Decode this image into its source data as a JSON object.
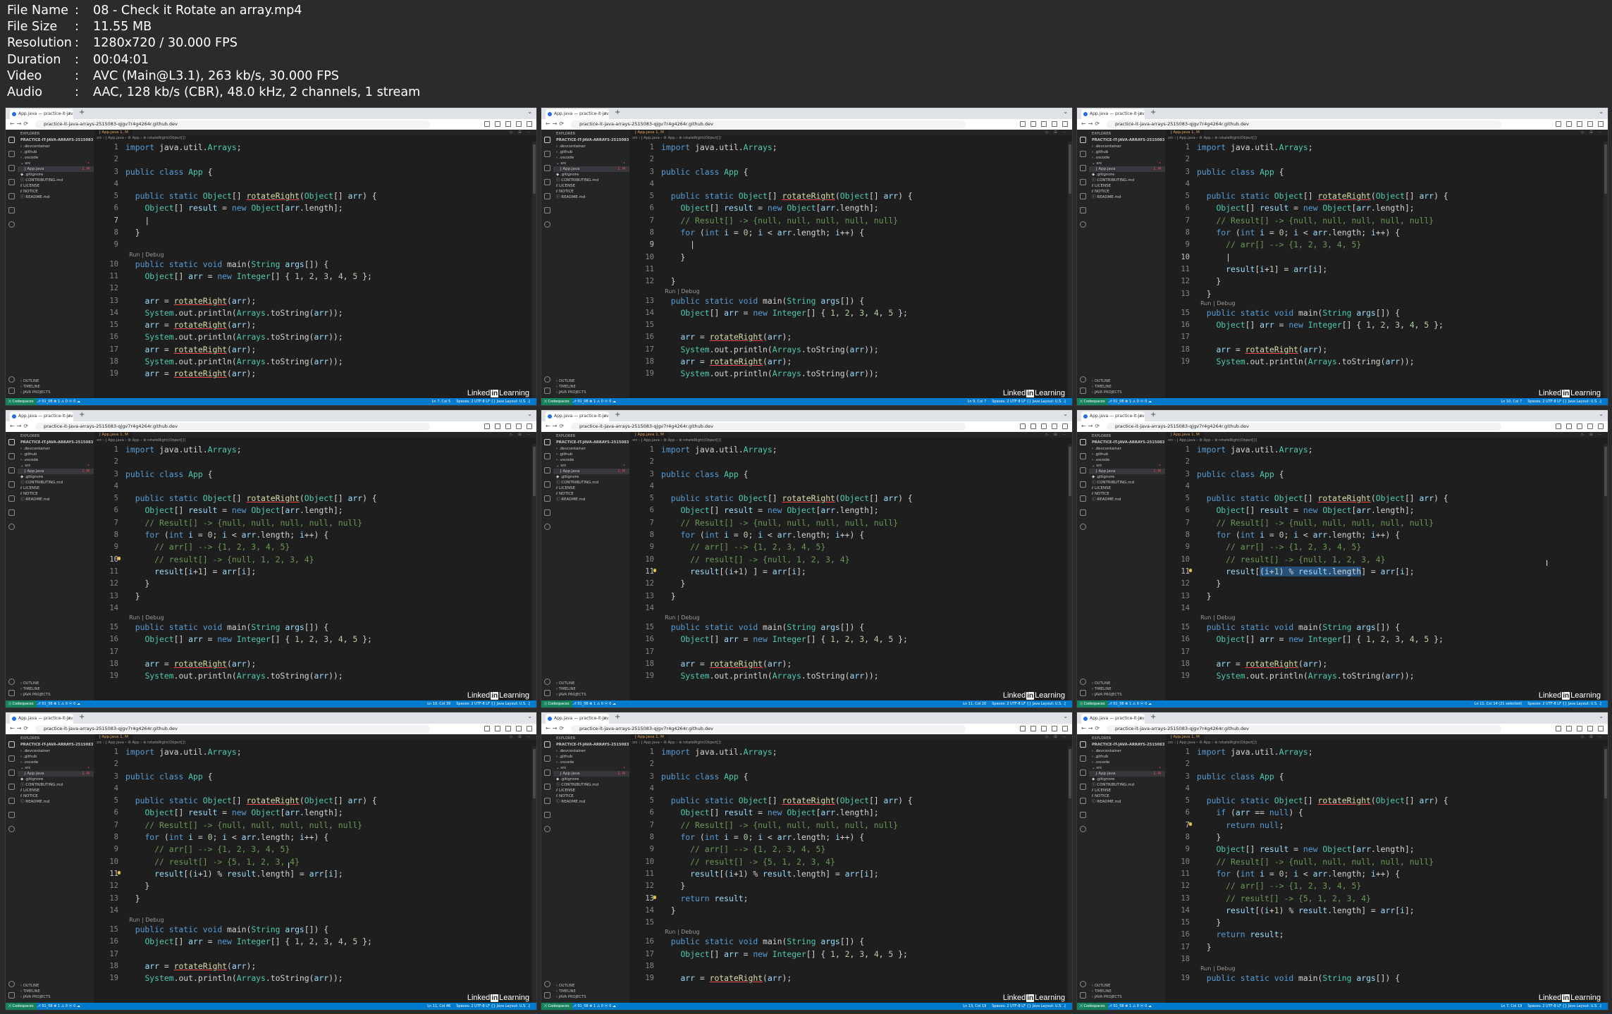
{
  "media_info": [
    {
      "label": "File Name",
      "value": "08 - Check it Rotate an array.mp4"
    },
    {
      "label": "File Size",
      "value": "11.55 MB"
    },
    {
      "label": "Resolution",
      "value": "1280x720 / 30.000 FPS"
    },
    {
      "label": "Duration",
      "value": "00:04:01"
    },
    {
      "label": "Video",
      "value": "AVC (Main@L3.1), 263 kb/s, 30.000 FPS"
    },
    {
      "label": "Audio",
      "value": "AAC, 128 kb/s (CBR), 48.0 kHz, 2 channels, 1 stream"
    }
  ],
  "browser": {
    "tab_title": "App.java — practice-it-java-a",
    "url": "practice-it-java-arrays-2515083-qjgv7r4g4264r.github.dev"
  },
  "explorer": {
    "title": "EXPLORER",
    "root": "PRACTICE-IT-JAVA-ARRAYS-2515083 [CODESPACES]",
    "items": [
      {
        "label": "› .devcontainer",
        "badge": "",
        "indent": 4
      },
      {
        "label": "› .github",
        "badge": "",
        "indent": 4
      },
      {
        "label": "› .vscode",
        "badge": "",
        "indent": 4
      },
      {
        "label": "⌄ src",
        "badge": "•",
        "badge_color": "red",
        "indent": 4
      },
      {
        "label": "J App.java",
        "badge": "1, M",
        "badge_color": "red",
        "indent": 10,
        "selected": true
      },
      {
        "label": "◆ .gitignore",
        "badge": "",
        "indent": 4
      },
      {
        "label": "ⓘ CONTRIBUTING.md",
        "badge": "",
        "indent": 4
      },
      {
        "label": "ℓ LICENSE",
        "badge": "",
        "indent": 4
      },
      {
        "label": "ℓ NOTICE",
        "badge": "",
        "indent": 4
      },
      {
        "label": "ⓘ README.md",
        "badge": "",
        "indent": 4
      }
    ],
    "bottom": [
      "› OUTLINE",
      "› TIMELINE",
      "› JAVA PROJECTS"
    ]
  },
  "editor": {
    "tab_label": "J App.java 1, M",
    "breadcrumb": "src › J App.java › ⚙ App › ⊕ rotateRight(Object[])"
  },
  "status": {
    "remote": "⟩⟨ Codespaces",
    "left": "⎇ 01_08   ⊗ 1 ⚠ 0   ⓦ 0   ☁",
    "right": "Spaces: 2   UTF-8   LF   {} Java   Layout: U.S.   ♫"
  },
  "watermark": {
    "pre": "Linked",
    "box": "in",
    "post": "Learning"
  },
  "frames": [
    {
      "status_pos": "Ln 7, Col 5",
      "lines": [
        {
          "n": "1",
          "t": "import java.util.Arrays;"
        },
        {
          "n": "2",
          "t": ""
        },
        {
          "n": "3",
          "t": "public class App {"
        },
        {
          "n": "4",
          "t": ""
        },
        {
          "n": "5",
          "t": "  public static Object[] rotateRight(Object[] arr) {"
        },
        {
          "n": "6",
          "t": "    Object[] result = new Object[arr.length];"
        },
        {
          "n": "7",
          "t": "    |",
          "cur": true
        },
        {
          "n": "8",
          "t": "  }"
        },
        {
          "n": "9",
          "t": ""
        },
        {
          "n": "",
          "t": "  Run | Debug",
          "lens": true
        },
        {
          "n": "10",
          "t": "  public static void main(String args[]) {"
        },
        {
          "n": "11",
          "t": "    Object[] arr = new Integer[] { 1, 2, 3, 4, 5 };"
        },
        {
          "n": "12",
          "t": ""
        },
        {
          "n": "13",
          "t": "    arr = rotateRight(arr);"
        },
        {
          "n": "14",
          "t": "    System.out.println(Arrays.toString(arr));"
        },
        {
          "n": "15",
          "t": "    arr = rotateRight(arr);"
        },
        {
          "n": "16",
          "t": "    System.out.println(Arrays.toString(arr));"
        },
        {
          "n": "17",
          "t": "    arr = rotateRight(arr);"
        },
        {
          "n": "18",
          "t": "    System.out.println(Arrays.toString(arr));"
        },
        {
          "n": "19",
          "t": "    arr = rotateRight(arr);"
        }
      ]
    },
    {
      "status_pos": "Ln 9, Col 7",
      "lines": [
        {
          "n": "1",
          "t": "import java.util.Arrays;"
        },
        {
          "n": "2",
          "t": ""
        },
        {
          "n": "3",
          "t": "public class App {"
        },
        {
          "n": "4",
          "t": ""
        },
        {
          "n": "5",
          "t": "  public static Object[] rotateRight(Object[] arr) {"
        },
        {
          "n": "6",
          "t": "    Object[] result = new Object[arr.length];"
        },
        {
          "n": "7",
          "t": "    // Result[] -> {null, null, null, null, null}"
        },
        {
          "n": "8",
          "t": "    for (int i = 0; i < arr.length; i++) {"
        },
        {
          "n": "9",
          "t": "      |",
          "cur": true
        },
        {
          "n": "10",
          "t": "    }"
        },
        {
          "n": "11",
          "t": ""
        },
        {
          "n": "12",
          "t": "  }"
        },
        {
          "n": "",
          "t": "  Run | Debug",
          "lens": true
        },
        {
          "n": "13",
          "t": "  public static void main(String args[]) {"
        },
        {
          "n": "14",
          "t": "    Object[] arr = new Integer[] { 1, 2, 3, 4, 5 };"
        },
        {
          "n": "15",
          "t": ""
        },
        {
          "n": "16",
          "t": "    arr = rotateRight(arr);"
        },
        {
          "n": "17",
          "t": "    System.out.println(Arrays.toString(arr));"
        },
        {
          "n": "18",
          "t": "    arr = rotateRight(arr);"
        },
        {
          "n": "19",
          "t": "    System.out.println(Arrays.toString(arr));"
        }
      ]
    },
    {
      "status_pos": "Ln 10, Col 7",
      "lines": [
        {
          "n": "1",
          "t": "import java.util.Arrays;"
        },
        {
          "n": "2",
          "t": ""
        },
        {
          "n": "3",
          "t": "public class App {"
        },
        {
          "n": "4",
          "t": ""
        },
        {
          "n": "5",
          "t": "  public static Object[] rotateRight(Object[] arr) {"
        },
        {
          "n": "6",
          "t": "    Object[] result = new Object[arr.length];"
        },
        {
          "n": "7",
          "t": "    // Result[] -> {null, null, null, null, null}"
        },
        {
          "n": "8",
          "t": "    for (int i = 0; i < arr.length; i++) {"
        },
        {
          "n": "9",
          "t": "      // arr[] --> {1, 2, 3, 4, 5}"
        },
        {
          "n": "10",
          "t": "      |",
          "cur": true
        },
        {
          "n": "11",
          "t": "      result[i+1] = arr[i];"
        },
        {
          "n": "12",
          "t": "    }"
        },
        {
          "n": "13",
          "t": "  }"
        },
        {
          "n": "",
          "t": "  Run | Debug",
          "lens": true
        },
        {
          "n": "15",
          "t": "  public static void main(String args[]) {"
        },
        {
          "n": "16",
          "t": "    Object[] arr = new Integer[] { 1, 2, 3, 4, 5 };"
        },
        {
          "n": "17",
          "t": ""
        },
        {
          "n": "18",
          "t": "    arr = rotateRight(arr);"
        },
        {
          "n": "19",
          "t": "    System.out.println(Arrays.toString(arr));"
        }
      ]
    },
    {
      "status_pos": "Ln 10, Col 39",
      "lines": [
        {
          "n": "1",
          "t": "import java.util.Arrays;"
        },
        {
          "n": "2",
          "t": ""
        },
        {
          "n": "3",
          "t": "public class App {"
        },
        {
          "n": "4",
          "t": ""
        },
        {
          "n": "5",
          "t": "  public static Object[] rotateRight(Object[] arr) {"
        },
        {
          "n": "6",
          "t": "    Object[] result = new Object[arr.length];"
        },
        {
          "n": "7",
          "t": "    // Result[] -> {null, null, null, null, null}"
        },
        {
          "n": "8",
          "t": "    for (int i = 0; i < arr.length; i++) {"
        },
        {
          "n": "9",
          "t": "      // arr[] --> {1, 2, 3, 4, 5}"
        },
        {
          "n": "10",
          "t": "      // result[] -> {null, 1, 2, 3, 4}",
          "cur": true,
          "bulb": true
        },
        {
          "n": "11",
          "t": "      result[i+1] = arr[i];"
        },
        {
          "n": "12",
          "t": "    }"
        },
        {
          "n": "13",
          "t": "  }"
        },
        {
          "n": "14",
          "t": ""
        },
        {
          "n": "",
          "t": "  Run | Debug",
          "lens": true
        },
        {
          "n": "15",
          "t": "  public static void main(String args[]) {"
        },
        {
          "n": "16",
          "t": "    Object[] arr = new Integer[] { 1, 2, 3, 4, 5 };"
        },
        {
          "n": "17",
          "t": ""
        },
        {
          "n": "18",
          "t": "    arr = rotateRight(arr);"
        },
        {
          "n": "19",
          "t": "    System.out.println(Arrays.toString(arr));"
        }
      ]
    },
    {
      "status_pos": "Ln 11, Col 20",
      "lines": [
        {
          "n": "1",
          "t": "import java.util.Arrays;"
        },
        {
          "n": "2",
          "t": ""
        },
        {
          "n": "3",
          "t": "public class App {"
        },
        {
          "n": "4",
          "t": ""
        },
        {
          "n": "5",
          "t": "  public static Object[] rotateRight(Object[] arr) {"
        },
        {
          "n": "6",
          "t": "    Object[] result = new Object[arr.length];"
        },
        {
          "n": "7",
          "t": "    // Result[] -> {null, null, null, null, null}"
        },
        {
          "n": "8",
          "t": "    for (int i = 0; i < arr.length; i++) {"
        },
        {
          "n": "9",
          "t": "      // arr[] --> {1, 2, 3, 4, 5}"
        },
        {
          "n": "10",
          "t": "      // result[] -> {null, 1, 2, 3, 4}"
        },
        {
          "n": "11",
          "t": "      result[(i+1) ] = arr[i];",
          "cur": true,
          "bulb": true
        },
        {
          "n": "12",
          "t": "    }"
        },
        {
          "n": "13",
          "t": "  }"
        },
        {
          "n": "14",
          "t": ""
        },
        {
          "n": "",
          "t": "  Run | Debug",
          "lens": true
        },
        {
          "n": "15",
          "t": "  public static void main(String args[]) {"
        },
        {
          "n": "16",
          "t": "    Object[] arr = new Integer[] { 1, 2, 3, 4, 5 };"
        },
        {
          "n": "17",
          "t": ""
        },
        {
          "n": "18",
          "t": "    arr = rotateRight(arr);"
        },
        {
          "n": "19",
          "t": "    System.out.println(Arrays.toString(arr));"
        }
      ]
    },
    {
      "status_pos": "Ln 11, Col 14 (21 selected)",
      "mouse": true,
      "lines": [
        {
          "n": "1",
          "t": "import java.util.Arrays;"
        },
        {
          "n": "2",
          "t": ""
        },
        {
          "n": "3",
          "t": "public class App {"
        },
        {
          "n": "4",
          "t": ""
        },
        {
          "n": "5",
          "t": "  public static Object[] rotateRight(Object[] arr) {"
        },
        {
          "n": "6",
          "t": "    Object[] result = new Object[arr.length];"
        },
        {
          "n": "7",
          "t": "    // Result[] -> {null, null, null, null, null}"
        },
        {
          "n": "8",
          "t": "    for (int i = 0; i < arr.length; i++) {"
        },
        {
          "n": "9",
          "t": "      // arr[] --> {1, 2, 3, 4, 5}"
        },
        {
          "n": "10",
          "t": "      // result[] -> {null, 1, 2, 3, 4}"
        },
        {
          "n": "11",
          "t": "      result[(i+1) % result.length] = arr[i];",
          "cur": true,
          "bulb": true
        },
        {
          "n": "12",
          "t": "    }"
        },
        {
          "n": "13",
          "t": "  }"
        },
        {
          "n": "14",
          "t": ""
        },
        {
          "n": "",
          "t": "  Run | Debug",
          "lens": true
        },
        {
          "n": "15",
          "t": "  public static void main(String args[]) {"
        },
        {
          "n": "16",
          "t": "    Object[] arr = new Integer[] { 1, 2, 3, 4, 5 };"
        },
        {
          "n": "17",
          "t": ""
        },
        {
          "n": "18",
          "t": "    arr = rotateRight(arr);"
        },
        {
          "n": "19",
          "t": "    System.out.println(Arrays.toString(arr));"
        }
      ]
    },
    {
      "status_pos": "Ln 11, Col 46",
      "mouse": true,
      "lines": [
        {
          "n": "1",
          "t": "import java.util.Arrays;"
        },
        {
          "n": "2",
          "t": ""
        },
        {
          "n": "3",
          "t": "public class App {"
        },
        {
          "n": "4",
          "t": ""
        },
        {
          "n": "5",
          "t": "  public static Object[] rotateRight(Object[] arr) {"
        },
        {
          "n": "6",
          "t": "    Object[] result = new Object[arr.length];"
        },
        {
          "n": "7",
          "t": "    // Result[] -> {null, null, null, null, null}"
        },
        {
          "n": "8",
          "t": "    for (int i = 0; i < arr.length; i++) {"
        },
        {
          "n": "9",
          "t": "      // arr[] --> {1, 2, 3, 4, 5}"
        },
        {
          "n": "10",
          "t": "      // result[] -> {5, 1, 2, 3, 4}"
        },
        {
          "n": "11",
          "t": "      result[(i+1) % result.length] = arr[i];",
          "cur": true,
          "bulb": true
        },
        {
          "n": "12",
          "t": "    }"
        },
        {
          "n": "13",
          "t": "  }"
        },
        {
          "n": "14",
          "t": ""
        },
        {
          "n": "",
          "t": "  Run | Debug",
          "lens": true
        },
        {
          "n": "15",
          "t": "  public static void main(String args[]) {"
        },
        {
          "n": "16",
          "t": "    Object[] arr = new Integer[] { 1, 2, 3, 4, 5 };"
        },
        {
          "n": "17",
          "t": ""
        },
        {
          "n": "18",
          "t": "    arr = rotateRight(arr);"
        },
        {
          "n": "19",
          "t": "    System.out.println(Arrays.toString(arr));"
        }
      ]
    },
    {
      "status_pos": "Ln 13, Col 19",
      "lines": [
        {
          "n": "1",
          "t": "import java.util.Arrays;"
        },
        {
          "n": "2",
          "t": ""
        },
        {
          "n": "3",
          "t": "public class App {"
        },
        {
          "n": "4",
          "t": ""
        },
        {
          "n": "5",
          "t": "  public static Object[] rotateRight(Object[] arr) {"
        },
        {
          "n": "6",
          "t": "    Object[] result = new Object[arr.length];"
        },
        {
          "n": "7",
          "t": "    // Result[] -> {null, null, null, null, null}"
        },
        {
          "n": "8",
          "t": "    for (int i = 0; i < arr.length; i++) {"
        },
        {
          "n": "9",
          "t": "      // arr[] --> {1, 2, 3, 4, 5}"
        },
        {
          "n": "10",
          "t": "      // result[] -> {5, 1, 2, 3, 4}"
        },
        {
          "n": "11",
          "t": "      result[(i+1) % result.length] = arr[i];"
        },
        {
          "n": "12",
          "t": "    }"
        },
        {
          "n": "13",
          "t": "    return result;",
          "cur": true,
          "bulb": true
        },
        {
          "n": "14",
          "t": "  }"
        },
        {
          "n": "15",
          "t": ""
        },
        {
          "n": "",
          "t": "  Run | Debug",
          "lens": true
        },
        {
          "n": "16",
          "t": "  public static void main(String args[]) {"
        },
        {
          "n": "17",
          "t": "    Object[] arr = new Integer[] { 1, 2, 3, 4, 5 };"
        },
        {
          "n": "18",
          "t": ""
        },
        {
          "n": "19",
          "t": "    arr = rotateRight(arr);"
        }
      ]
    },
    {
      "status_pos": "Ln 7, Col 19",
      "lines": [
        {
          "n": "1",
          "t": "import java.util.Arrays;"
        },
        {
          "n": "2",
          "t": ""
        },
        {
          "n": "3",
          "t": "public class App {"
        },
        {
          "n": "4",
          "t": ""
        },
        {
          "n": "5",
          "t": "  public static Object[] rotateRight(Object[] arr) {"
        },
        {
          "n": "6",
          "t": "    if (arr == null) {"
        },
        {
          "n": "7",
          "t": "      return null;",
          "cur": true,
          "bulb": true
        },
        {
          "n": "8",
          "t": "    }"
        },
        {
          "n": "9",
          "t": "    Object[] result = new Object[arr.length];"
        },
        {
          "n": "10",
          "t": "    // Result[] -> {null, null, null, null, null}"
        },
        {
          "n": "11",
          "t": "    for (int i = 0; i < arr.length; i++) {"
        },
        {
          "n": "12",
          "t": "      // arr[] --> {1, 2, 3, 4, 5}"
        },
        {
          "n": "13",
          "t": "      // result[] -> {5, 1, 2, 3, 4}"
        },
        {
          "n": "14",
          "t": "      result[(i+1) % result.length] = arr[i];"
        },
        {
          "n": "15",
          "t": "    }"
        },
        {
          "n": "16",
          "t": "    return result;"
        },
        {
          "n": "17",
          "t": "  }"
        },
        {
          "n": "18",
          "t": ""
        },
        {
          "n": "",
          "t": "  Run | Debug",
          "lens": true
        },
        {
          "n": "19",
          "t": "  public static void main(String args[]) {"
        }
      ]
    }
  ]
}
